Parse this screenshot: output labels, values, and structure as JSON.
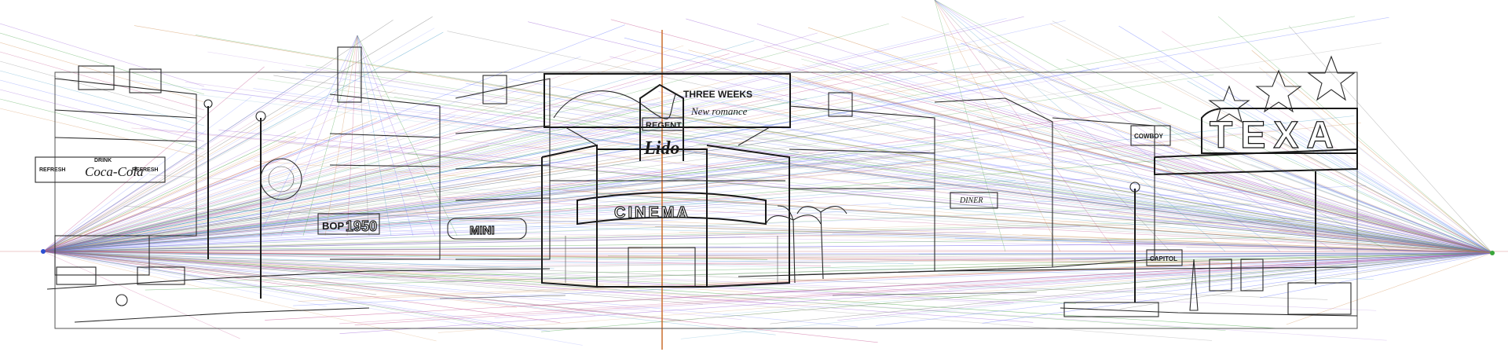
{
  "canvas": {
    "vanishing_point_left_color": "#2b4fd1",
    "vanishing_point_right_color": "#3aa63a",
    "guide_colors": [
      "#6b7cff",
      "#9a5fd6",
      "#3c9e3c",
      "#d08a4a",
      "#c24a8a",
      "#7a7a7a",
      "#4aa0c8"
    ],
    "center_guide_color": "#c8641e",
    "ink_color": "#1a1a1a",
    "frame_color": "#555555"
  },
  "signs": {
    "cinema": "CINEMA",
    "lido": "Lido",
    "regent": "REGENT",
    "texas": "TEXA",
    "year": "1950",
    "bop": "BOP",
    "mini": "MINI",
    "coca_cola": "Coca-Cola",
    "drink": "DRINK",
    "refresh_left": "REFRESH",
    "refresh_right": "REFRESH",
    "billboard_title": "THREE WEEKS",
    "billboard_subtitle": "New romance",
    "capitol": "CAPITOL",
    "diner": "DINER",
    "cowboy": "COWBOY"
  }
}
